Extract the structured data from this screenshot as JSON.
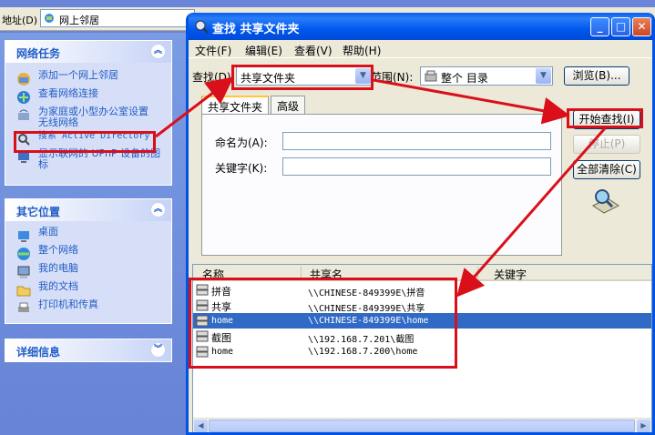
{
  "explorer": {
    "address_label": "地址(D)",
    "address_value": "网上邻居",
    "network_tasks": {
      "title": "网络任务",
      "items": [
        {
          "label": "添加一个网上邻居",
          "icon": "add-network-place-icon"
        },
        {
          "label": "查看网络连接",
          "icon": "network-connections-icon"
        },
        {
          "label": "为家庭或小型办公室设置无线网络",
          "icon": "wireless-setup-icon"
        },
        {
          "label": "搜索 Active Directory",
          "icon": "search-directory-icon"
        },
        {
          "label": "显示联网的 UPnP 设备的图标",
          "icon": "upnp-devices-icon"
        }
      ]
    },
    "other_places": {
      "title": "其它位置",
      "items": [
        {
          "label": "桌面",
          "icon": "desktop-icon"
        },
        {
          "label": "整个网络",
          "icon": "entire-network-icon"
        },
        {
          "label": "我的电脑",
          "icon": "my-computer-icon"
        },
        {
          "label": "我的文档",
          "icon": "my-documents-icon"
        },
        {
          "label": "打印机和传真",
          "icon": "printers-faxes-icon"
        }
      ]
    },
    "details": {
      "title": "详细信息"
    }
  },
  "dialog": {
    "title": "查找 共享文件夹",
    "title_buttons": {
      "minimize": "_",
      "maximize": "□",
      "close": "✕"
    },
    "menu": [
      "文件(F)",
      "编辑(E)",
      "查看(V)",
      "帮助(H)"
    ],
    "find_label": "查找(D):",
    "find_value": "共享文件夹",
    "scope_label": "范围(N):",
    "scope_value": "整个 目录",
    "browse_button": "浏览(B)...",
    "tabs": [
      "共享文件夹",
      "高级"
    ],
    "name_label": "命名为(A):",
    "keyword_label": "关键字(K):",
    "name_value": "",
    "keyword_value": "",
    "start_button": "开始查找(I)",
    "stop_button": "停止(P)",
    "clear_button": "全部清除(C)",
    "results": {
      "columns": [
        "名称",
        "共享名",
        "关键字"
      ],
      "rows": [
        {
          "name": "拼音",
          "share": "\\\\CHINESE-849399E\\拼音",
          "selected": false
        },
        {
          "name": "共享",
          "share": "\\\\CHINESE-849399E\\共享",
          "selected": false
        },
        {
          "name": "home",
          "share": "\\\\CHINESE-849399E\\home",
          "selected": true
        },
        {
          "name": "截图",
          "share": "\\\\192.168.7.201\\截图",
          "selected": false
        },
        {
          "name": "home",
          "share": "\\\\192.168.7.200\\home",
          "selected": false
        }
      ]
    }
  },
  "colors": {
    "annotation_red": "#d9101a",
    "xp_blue": "#0054e3",
    "selection": "#316ac5"
  }
}
